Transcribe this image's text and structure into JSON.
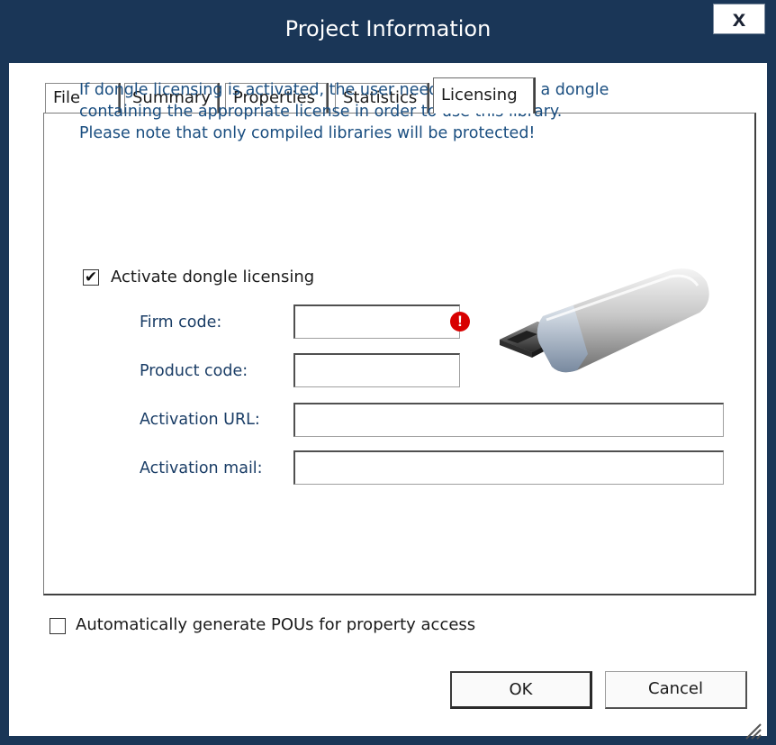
{
  "window": {
    "title": "Project Information",
    "close_label": "x"
  },
  "tabs": [
    {
      "label": "File"
    },
    {
      "label": "Summary"
    },
    {
      "label": "Properties"
    },
    {
      "label": "Statistics"
    },
    {
      "label": "Licensing"
    }
  ],
  "active_tab": "Licensing",
  "licensing": {
    "info_lines": [
      "If dongle licensing is activated, the user needs to connect a dongle",
      "containing the appropriate license in order to use this library.",
      "Please note that only compiled libraries will be protected!"
    ],
    "activate_label": "Activate dongle licensing",
    "activate_checked": true,
    "check_mark": "✔",
    "error_mark": "!",
    "fields": {
      "firm_code": {
        "label": "Firm code:",
        "value": ""
      },
      "product_code": {
        "label": "Product code:",
        "value": ""
      },
      "activation_url": {
        "label": "Activation URL:",
        "value": ""
      },
      "activation_mail": {
        "label": "Activation mail:",
        "value": ""
      }
    }
  },
  "auto_generate": {
    "label": "Automatically generate POUs for property access",
    "checked": false
  },
  "buttons": {
    "ok": "OK",
    "cancel": "Cancel"
  },
  "icons": {
    "close": "close-icon",
    "error": "error-icon",
    "usb": "usb-dongle-icon",
    "grip": "resize-grip-icon"
  },
  "colors": {
    "titlebar": "#1a3657",
    "info_text": "#1a4e80",
    "label_text": "#1a3d66",
    "error": "#d80000"
  }
}
